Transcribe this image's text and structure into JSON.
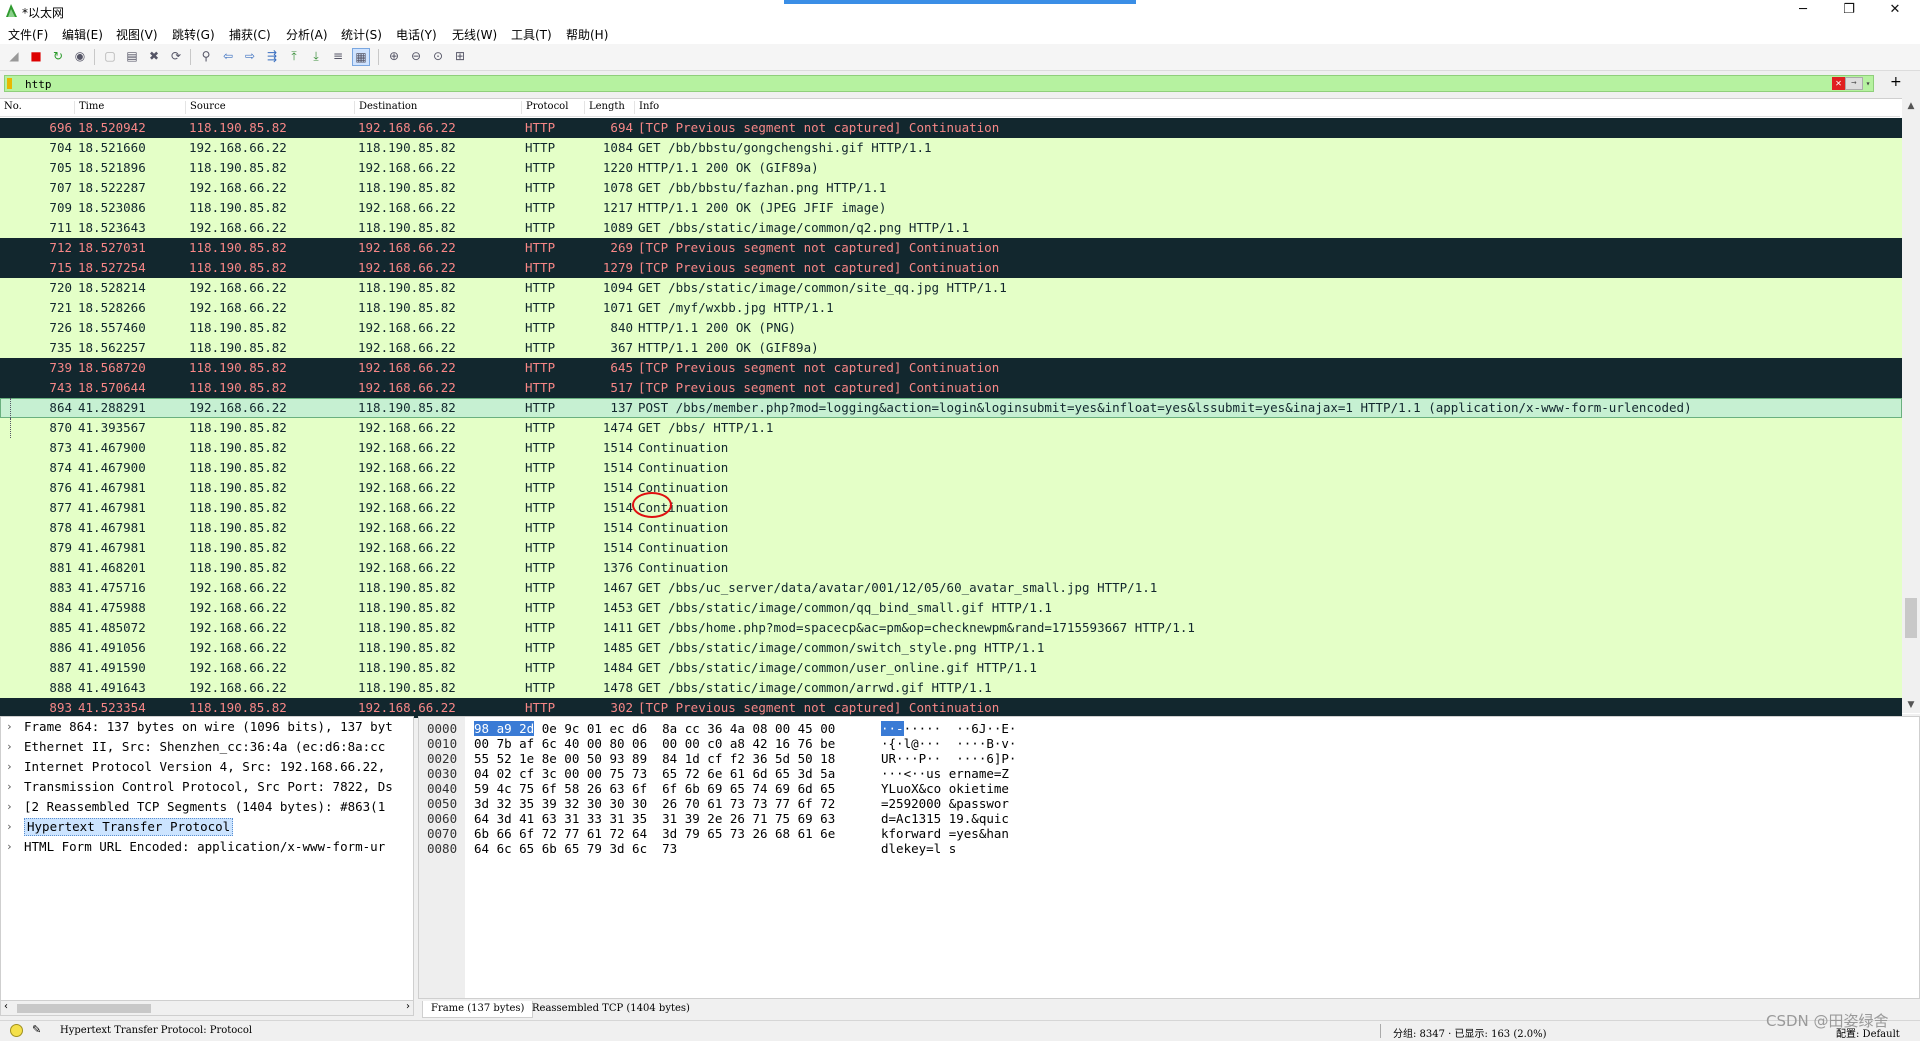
{
  "window": {
    "title": "*以太网",
    "controls": [
      "─",
      "❐",
      "✕"
    ]
  },
  "menu": [
    "文件(F)",
    "编辑(E)",
    "视图(V)",
    "跳转(G)",
    "捕获(C)",
    "分析(A)",
    "统计(S)",
    "电话(Y)",
    "无线(W)",
    "工具(T)",
    "帮助(H)"
  ],
  "toolbar": {
    "icons": [
      "shark-fin-start-icon",
      "stop-capture-icon",
      "restart-capture-icon",
      "capture-options-icon",
      "open-file-icon",
      "save-file-icon",
      "close-file-icon",
      "reload-file-icon",
      "find-packet-icon",
      "go-back-icon",
      "go-forward-icon",
      "go-to-packet-icon",
      "first-packet-icon",
      "last-packet-icon",
      "auto-scroll-icon",
      "colorize-icon",
      "zoom-in-icon",
      "zoom-out-icon",
      "normal-size-icon",
      "resize-columns-icon"
    ],
    "glyphs": [
      "◢",
      "■",
      "↻",
      "◉",
      "▢",
      "▤",
      "✖",
      "⟳",
      "⚲",
      "⇦",
      "⇨",
      "⇶",
      "⤒",
      "⤓",
      "≡",
      "▦",
      "⊕",
      "⊖",
      "⊙",
      "⊞"
    ]
  },
  "filter": {
    "value": "http",
    "clear": "✕",
    "apply": "→",
    "dropdown": "▾",
    "add": "+"
  },
  "packet_list": {
    "columns": [
      "No.",
      "Time",
      "Source",
      "Destination",
      "Protocol",
      "Length",
      "Info"
    ],
    "rows": [
      {
        "no": "696",
        "time": "18.520942",
        "src": "118.190.85.82",
        "dst": "192.168.66.22",
        "proto": "HTTP",
        "len": "694",
        "info": "[TCP Previous segment not captured] Continuation",
        "style": "dark"
      },
      {
        "no": "704",
        "time": "18.521660",
        "src": "192.168.66.22",
        "dst": "118.190.85.82",
        "proto": "HTTP",
        "len": "1084",
        "info": "GET /bb/bbstu/gongchengshi.gif HTTP/1.1",
        "style": "normal"
      },
      {
        "no": "705",
        "time": "18.521896",
        "src": "118.190.85.82",
        "dst": "192.168.66.22",
        "proto": "HTTP",
        "len": "1220",
        "info": "HTTP/1.1 200 OK  (GIF89a)",
        "style": "normal"
      },
      {
        "no": "707",
        "time": "18.522287",
        "src": "192.168.66.22",
        "dst": "118.190.85.82",
        "proto": "HTTP",
        "len": "1078",
        "info": "GET /bb/bbstu/fazhan.png HTTP/1.1",
        "style": "normal"
      },
      {
        "no": "709",
        "time": "18.523086",
        "src": "118.190.85.82",
        "dst": "192.168.66.22",
        "proto": "HTTP",
        "len": "1217",
        "info": "HTTP/1.1 200 OK  (JPEG JFIF image)",
        "style": "normal"
      },
      {
        "no": "711",
        "time": "18.523643",
        "src": "192.168.66.22",
        "dst": "118.190.85.82",
        "proto": "HTTP",
        "len": "1089",
        "info": "GET /bbs/static/image/common/q2.png HTTP/1.1",
        "style": "normal"
      },
      {
        "no": "712",
        "time": "18.527031",
        "src": "118.190.85.82",
        "dst": "192.168.66.22",
        "proto": "HTTP",
        "len": "269",
        "info": "[TCP Previous segment not captured] Continuation",
        "style": "dark"
      },
      {
        "no": "715",
        "time": "18.527254",
        "src": "118.190.85.82",
        "dst": "192.168.66.22",
        "proto": "HTTP",
        "len": "1279",
        "info": "[TCP Previous segment not captured] Continuation",
        "style": "dark"
      },
      {
        "no": "720",
        "time": "18.528214",
        "src": "192.168.66.22",
        "dst": "118.190.85.82",
        "proto": "HTTP",
        "len": "1094",
        "info": "GET /bbs/static/image/common/site_qq.jpg HTTP/1.1",
        "style": "normal"
      },
      {
        "no": "721",
        "time": "18.528266",
        "src": "192.168.66.22",
        "dst": "118.190.85.82",
        "proto": "HTTP",
        "len": "1071",
        "info": "GET /myf/wxbb.jpg HTTP/1.1",
        "style": "normal"
      },
      {
        "no": "726",
        "time": "18.557460",
        "src": "118.190.85.82",
        "dst": "192.168.66.22",
        "proto": "HTTP",
        "len": "840",
        "info": "HTTP/1.1 200 OK  (PNG)",
        "style": "normal"
      },
      {
        "no": "735",
        "time": "18.562257",
        "src": "118.190.85.82",
        "dst": "192.168.66.22",
        "proto": "HTTP",
        "len": "367",
        "info": "HTTP/1.1 200 OK  (GIF89a)",
        "style": "normal"
      },
      {
        "no": "739",
        "time": "18.568720",
        "src": "118.190.85.82",
        "dst": "192.168.66.22",
        "proto": "HTTP",
        "len": "645",
        "info": "[TCP Previous segment not captured] Continuation",
        "style": "dark"
      },
      {
        "no": "743",
        "time": "18.570644",
        "src": "118.190.85.82",
        "dst": "192.168.66.22",
        "proto": "HTTP",
        "len": "517",
        "info": "[TCP Previous segment not captured] Continuation",
        "style": "dark"
      },
      {
        "no": "864",
        "time": "41.288291",
        "src": "192.168.66.22",
        "dst": "118.190.85.82",
        "proto": "HTTP",
        "len": "137",
        "info": "POST /bbs/member.php?mod=logging&action=login&loginsubmit=yes&infloat=yes&lssubmit=yes&inajax=1 HTTP/1.1  (application/x-www-form-urlencoded)",
        "style": "sel"
      },
      {
        "no": "870",
        "time": "41.393567",
        "src": "118.190.85.82",
        "dst": "192.168.66.22",
        "proto": "HTTP",
        "len": "1474",
        "info": "GET /bbs/ HTTP/1.1",
        "style": "normal"
      },
      {
        "no": "873",
        "time": "41.467900",
        "src": "118.190.85.82",
        "dst": "192.168.66.22",
        "proto": "HTTP",
        "len": "1514",
        "info": "Continuation",
        "style": "normal"
      },
      {
        "no": "874",
        "time": "41.467900",
        "src": "118.190.85.82",
        "dst": "192.168.66.22",
        "proto": "HTTP",
        "len": "1514",
        "info": "Continuation",
        "style": "normal"
      },
      {
        "no": "876",
        "time": "41.467981",
        "src": "118.190.85.82",
        "dst": "192.168.66.22",
        "proto": "HTTP",
        "len": "1514",
        "info": "Continuation",
        "style": "normal"
      },
      {
        "no": "877",
        "time": "41.467981",
        "src": "118.190.85.82",
        "dst": "192.168.66.22",
        "proto": "HTTP",
        "len": "1514",
        "info": "Continuation",
        "style": "normal"
      },
      {
        "no": "878",
        "time": "41.467981",
        "src": "118.190.85.82",
        "dst": "192.168.66.22",
        "proto": "HTTP",
        "len": "1514",
        "info": "Continuation",
        "style": "normal"
      },
      {
        "no": "879",
        "time": "41.467981",
        "src": "118.190.85.82",
        "dst": "192.168.66.22",
        "proto": "HTTP",
        "len": "1514",
        "info": "Continuation",
        "style": "normal"
      },
      {
        "no": "881",
        "time": "41.468201",
        "src": "118.190.85.82",
        "dst": "192.168.66.22",
        "proto": "HTTP",
        "len": "1376",
        "info": "Continuation",
        "style": "normal"
      },
      {
        "no": "883",
        "time": "41.475716",
        "src": "192.168.66.22",
        "dst": "118.190.85.82",
        "proto": "HTTP",
        "len": "1467",
        "info": "GET /bbs/uc_server/data/avatar/001/12/05/60_avatar_small.jpg HTTP/1.1",
        "style": "normal"
      },
      {
        "no": "884",
        "time": "41.475988",
        "src": "192.168.66.22",
        "dst": "118.190.85.82",
        "proto": "HTTP",
        "len": "1453",
        "info": "GET /bbs/static/image/common/qq_bind_small.gif HTTP/1.1",
        "style": "normal"
      },
      {
        "no": "885",
        "time": "41.485072",
        "src": "192.168.66.22",
        "dst": "118.190.85.82",
        "proto": "HTTP",
        "len": "1411",
        "info": "GET /bbs/home.php?mod=spacecp&ac=pm&op=checknewpm&rand=1715593667 HTTP/1.1",
        "style": "normal"
      },
      {
        "no": "886",
        "time": "41.491056",
        "src": "192.168.66.22",
        "dst": "118.190.85.82",
        "proto": "HTTP",
        "len": "1485",
        "info": "GET /bbs/static/image/common/switch_style.png HTTP/1.1",
        "style": "normal"
      },
      {
        "no": "887",
        "time": "41.491590",
        "src": "192.168.66.22",
        "dst": "118.190.85.82",
        "proto": "HTTP",
        "len": "1484",
        "info": "GET /bbs/static/image/common/user_online.gif HTTP/1.1",
        "style": "normal"
      },
      {
        "no": "888",
        "time": "41.491643",
        "src": "192.168.66.22",
        "dst": "118.190.85.82",
        "proto": "HTTP",
        "len": "1478",
        "info": "GET /bbs/static/image/common/arrwd.gif HTTP/1.1",
        "style": "normal"
      },
      {
        "no": "893",
        "time": "41.523354",
        "src": "118.190.85.82",
        "dst": "192.168.66.22",
        "proto": "HTTP",
        "len": "302",
        "info": "[TCP Previous segment not captured] Continuation",
        "style": "dark"
      }
    ]
  },
  "details": {
    "items": [
      {
        "chev": "›",
        "text": "Frame 864: 137 bytes on wire (1096 bits), 137 byt",
        "hl": false
      },
      {
        "chev": "›",
        "text": "Ethernet II, Src: Shenzhen_cc:36:4a (ec:d6:8a:cc",
        "hl": false
      },
      {
        "chev": "›",
        "text": "Internet Protocol Version 4, Src: 192.168.66.22,",
        "hl": false
      },
      {
        "chev": "›",
        "text": "Transmission Control Protocol, Src Port: 7822, Ds",
        "hl": false
      },
      {
        "chev": "›",
        "text": "[2 Reassembled TCP Segments (1404 bytes): #863(1",
        "hl": false
      },
      {
        "chev": "›",
        "text": "Hypertext Transfer Protocol",
        "hl": true
      },
      {
        "chev": "›",
        "text": "HTML Form URL Encoded: application/x-www-form-ur",
        "hl": false
      }
    ],
    "scroll_left": "‹",
    "scroll_right": "›"
  },
  "bytes": {
    "rows": [
      {
        "off": "0000",
        "sel": "98 a9 2d",
        "hex": " 0e 9c 01 ec d6  8a cc 36 4a 08 00 45 00",
        "asc_sel": "··-",
        "asc": "·····  ··6J··E·"
      },
      {
        "off": "0010",
        "sel": "",
        "hex": "00 7b af 6c 40 00 80 06  00 00 c0 a8 42 16 76 be",
        "asc_sel": "",
        "asc": "·{·l@···  ····B·v·"
      },
      {
        "off": "0020",
        "sel": "",
        "hex": "55 52 1e 8e 00 50 93 89  84 1d cf f2 36 5d 50 18",
        "asc_sel": "",
        "asc": "UR···P··  ····6]P·"
      },
      {
        "off": "0030",
        "sel": "",
        "hex": "04 02 cf 3c 00 00 75 73  65 72 6e 61 6d 65 3d 5a",
        "asc_sel": "",
        "asc": "···<··us ername=Z"
      },
      {
        "off": "0040",
        "sel": "",
        "hex": "59 4c 75 6f 58 26 63 6f  6f 6b 69 65 74 69 6d 65",
        "asc_sel": "",
        "asc": "YLuoX&co okietime"
      },
      {
        "off": "0050",
        "sel": "",
        "hex": "3d 32 35 39 32 30 30 30  26 70 61 73 73 77 6f 72",
        "asc_sel": "",
        "asc": "=2592000 &passwor"
      },
      {
        "off": "0060",
        "sel": "",
        "hex": "64 3d 41 63 31 33 31 35  31 39 2e 26 71 75 69 63",
        "asc_sel": "",
        "asc": "d=Ac1315 19.&quic"
      },
      {
        "off": "0070",
        "sel": "",
        "hex": "6b 66 6f 72 77 61 72 64  3d 79 65 73 26 68 61 6e",
        "asc_sel": "",
        "asc": "kforward =yes&han"
      },
      {
        "off": "0080",
        "sel": "",
        "hex": "64 6c 65 6b 65 79 3d 6c  73",
        "asc_sel": "",
        "asc": "dlekey=l s"
      }
    ],
    "tabs": [
      "Frame (137 bytes)",
      "Reassembled TCP (1404 bytes)"
    ]
  },
  "status": {
    "text": "Hypertext Transfer Protocol: Protocol",
    "counts": "分组: 8347 · 已显示: 163 (2.0%)",
    "profile": "配置: Default"
  },
  "watermark": "CSDN @田姿绿舍",
  "colors": {
    "row_normal": "#e4ffc7",
    "row_dark": "#12272e",
    "row_dark_text": "#f78787",
    "filter_bg": "#b6f2a0",
    "selected_row": "#c6f0d2",
    "annotation": "#e01010"
  }
}
